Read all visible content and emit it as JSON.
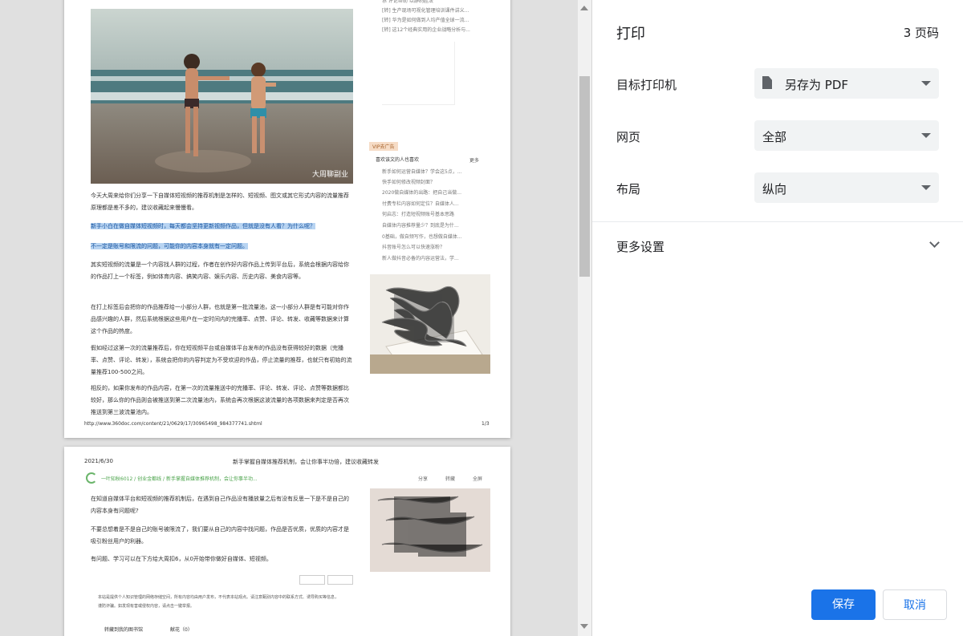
{
  "panel": {
    "title": "打印",
    "page_count": "3 页码",
    "destination_label": "目标打印机",
    "destination_value": "另存为 PDF",
    "pages_label": "网页",
    "pages_value": "全部",
    "layout_label": "布局",
    "layout_value": "纵向",
    "more_settings": "更多设置",
    "save_label": "保存",
    "cancel_label": "取消"
  },
  "preview": {
    "page1": {
      "watermark": "大周聊副业",
      "paragraphs": [
        "今天大周来给你们分享一下自媒体短视频的推荐机制是怎样的、短视频、图文或其它形式内容的流量推荐原理都是差不多的，建议收藏起来慢慢看。",
        "新手小白在做自媒体短视频时，每天都会坚持更新视频作品，但就是没有人看？为什么呢？",
        "不一定是账号和限流的问题，可能你的内容本身就有一定问题。",
        "其实短视频的流量是一个内容找人群的过程，作者在创作好内容作品上传到平台后，系统会根据内容给你的作品打上一个标签，例如体育内容、搞笑内容、娱乐内容、历史内容、美食内容等。",
        "在打上标签后会把你的作品推荐给一小部分人群，也就是第一批流量池，这一小部分人群是有可能对你作品感兴趣的人群，然后系统根据这些用户在一定时间内的完播率、点赞、评论、转发、收藏等数据来计算这个作品的热度。",
        "假如经过这第一次的流量推荐后，你在短视频平台或自媒体平台发布的作品没有获得较好的数据（完播率、点赞、评论、转发），系统会把你的内容判定为不受欢迎的作品，停止流量的推荐，也就只有初始的流量推荐100-500之间。",
        "相反的，如果你发布的作品内容，在第一次的流量推送中的完播率、评论、转发、评论、点赞等数据都比较好，那么你的作品则会被推送到第二次流量池内，系统会再次根据这波流量的各项数据来判定是否再次推送到第三波流量池内。"
      ],
      "side_top": [
        "系  评论帮助      以静制胜法",
        "[转] 生产现场可视化管理培训课件讲义...",
        "[转] 华为是如何做到人均产值全球一流...",
        "[转] 这12个经典实用的企业战略分析与..."
      ],
      "ad_tag": "VIP去广告",
      "side_section_title": "喜欢该文的人也喜欢",
      "side_more": "更多",
      "side_list": [
        "新手如何运营自媒体？学会这5点，...",
        "快手如何修改视频封面？",
        "2020做自媒体的出路：把自己当做...",
        "付费专栏内容如何定位？自媒体人...",
        "何启志：打造短视频账号基本思路",
        "自媒体内容推荐量少？到底是为什...",
        "0基础，做自频写作，也想做自媒体...",
        "抖音账号怎么可以快速涨粉？",
        "新人做抖音必备的内容运营法，学..."
      ],
      "footer_url": "http://www.360doc.com/content/21/0629/17/30965498_984377741.shtml",
      "footer_page": "1/3"
    },
    "page2": {
      "date": "2021/6/30",
      "header_title": "新手掌握自媒体推荐机制，会让你事半功倍，建议收藏转发",
      "breadcrumb": "一叶知秋6012 / 创业金都线 / 新手掌握自媒体推荐机制，会让你事半功...",
      "actions": [
        "分享",
        "转藏",
        "全屏"
      ],
      "paragraphs": [
        "在知道自媒体平台和短视频的推荐机制后，在遇到自己作品没有播放量之后有没有反思一下是不是自己的内容本身有问题呢?",
        "不要总想着是不是自己的账号被限流了，我们要从自己的内容中找问题，作品是否优质，优质的内容才是吸引粉丝用户的利器。",
        "有问题、学习可以在下方给大周扣6，从0开始带你做好自媒体、短视频。"
      ],
      "disclaimer": "本站是提供个人知识管理的网络存储空间，所有内容均由用户发布，不代表本站观点。请注意甄别内容中的联系方式、诱导购买等信息，谨防诈骗。如发现有害或侵权内容，请点击一键举报。",
      "bottom_links": [
        "转藏到我的图书馆",
        "献花（0）"
      ]
    }
  }
}
